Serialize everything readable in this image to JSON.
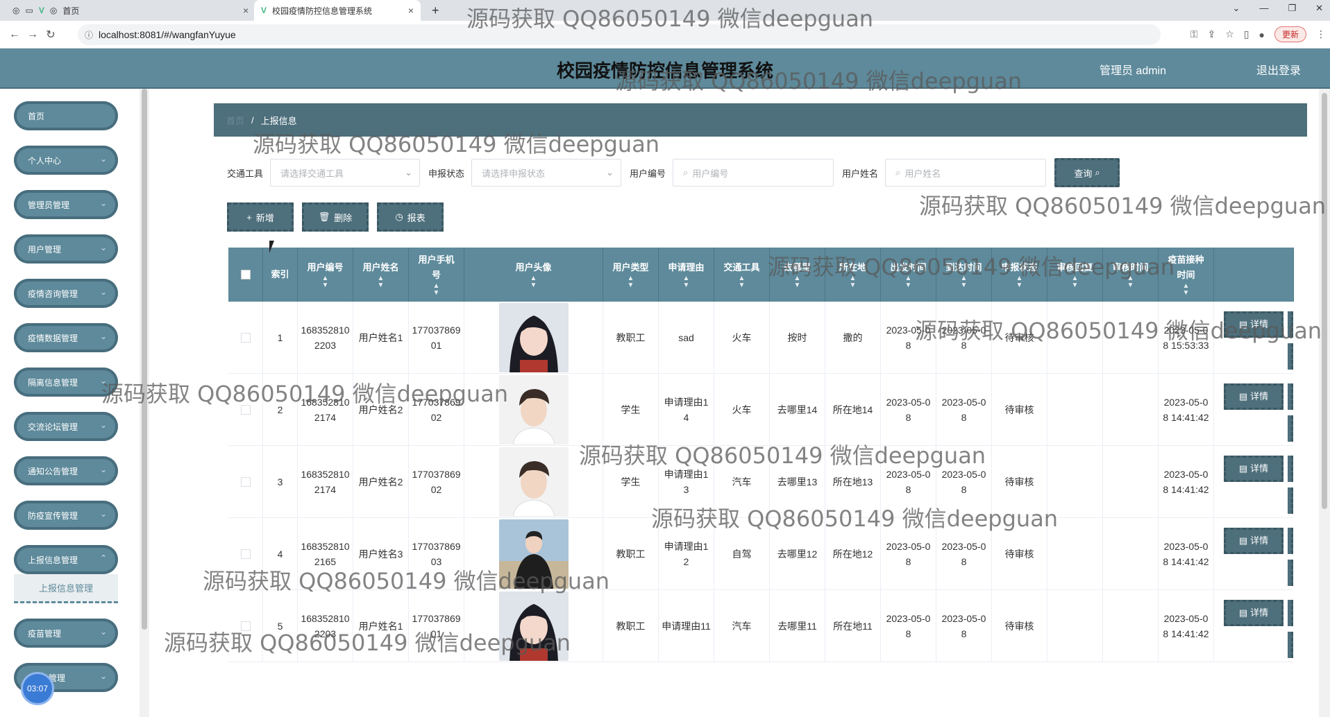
{
  "browser": {
    "tabs": [
      {
        "label": "首页",
        "active": false
      },
      {
        "label": "校园疫情防控信息管理系统",
        "active": true
      }
    ],
    "url": "localhost:8081/#/wangfanYuyue",
    "update_label": "更新"
  },
  "header": {
    "title": "校园疫情防控信息管理系统",
    "user": "管理员 admin",
    "logout": "退出登录"
  },
  "sidebar": {
    "items": [
      {
        "label": "首页"
      },
      {
        "label": "个人中心"
      },
      {
        "label": "管理员管理"
      },
      {
        "label": "用户管理"
      },
      {
        "label": "疫情咨询管理"
      },
      {
        "label": "疫情数据管理"
      },
      {
        "label": "隔离信息管理"
      },
      {
        "label": "交流论坛管理"
      },
      {
        "label": "通知公告管理"
      },
      {
        "label": "防疫宣传管理"
      },
      {
        "label": "上报信息管理"
      },
      {
        "label": "疫苗管理"
      },
      {
        "label": "管理"
      }
    ],
    "active_sub": "上报信息管理",
    "timer": "03:07"
  },
  "breadcrumb": {
    "home": "首页",
    "current": "上报信息"
  },
  "filters": {
    "transport_label": "交通工具",
    "transport_placeholder": "请选择交通工具",
    "status_label": "申报状态",
    "status_placeholder": "请选择申报状态",
    "userno_label": "用户编号",
    "userno_placeholder": "用户编号",
    "username_label": "用户姓名",
    "username_placeholder": "用户姓名",
    "query_label": "查询"
  },
  "actions": {
    "add": "新增",
    "delete": "删除",
    "report": "报表"
  },
  "table": {
    "columns": [
      "索引",
      "用户编号",
      "用户姓名",
      "用户手机号",
      "用户头像",
      "用户类型",
      "申请理由",
      "交通工具",
      "去哪里",
      "所在地",
      "出发时间",
      "到达时间",
      "申报状态",
      "审核回复",
      "审核时间",
      "疫苗接种时间"
    ],
    "detail_label": "详情",
    "rows": [
      {
        "idx": "1",
        "userno": "1683528102203",
        "name": "用户姓名1",
        "phone": "17703786901",
        "type": "教职工",
        "reason": "sad",
        "transport": "火车",
        "dest": "按时",
        "loc": "撒的",
        "depart": "2023-05-08",
        "arrive": "2023-05-08",
        "status": "待审核",
        "reply": "",
        "audit_time": "",
        "vaccine": "2023-05-08 15:53:33",
        "avatar": "girl"
      },
      {
        "idx": "2",
        "userno": "1683528102174",
        "name": "用户姓名2",
        "phone": "17703786902",
        "type": "学生",
        "reason": "申请理由14",
        "transport": "火车",
        "dest": "去哪里14",
        "loc": "所在地14",
        "depart": "2023-05-08",
        "arrive": "2023-05-08",
        "status": "待审核",
        "reply": "",
        "audit_time": "",
        "vaccine": "2023-05-08 14:41:42",
        "avatar": "boy"
      },
      {
        "idx": "3",
        "userno": "1683528102174",
        "name": "用户姓名2",
        "phone": "17703786902",
        "type": "学生",
        "reason": "申请理由13",
        "transport": "汽车",
        "dest": "去哪里13",
        "loc": "所在地13",
        "depart": "2023-05-08",
        "arrive": "2023-05-08",
        "status": "待审核",
        "reply": "",
        "audit_time": "",
        "vaccine": "2023-05-08 14:41:42",
        "avatar": "boy"
      },
      {
        "idx": "4",
        "userno": "1683528102165",
        "name": "用户姓名3",
        "phone": "17703786903",
        "type": "教职工",
        "reason": "申请理由12",
        "transport": "自驾",
        "dest": "去哪里12",
        "loc": "所在地12",
        "depart": "2023-05-08",
        "arrive": "2023-05-08",
        "status": "待审核",
        "reply": "",
        "audit_time": "",
        "vaccine": "2023-05-08 14:41:42",
        "avatar": "man"
      },
      {
        "idx": "5",
        "userno": "1683528102203",
        "name": "用户姓名1",
        "phone": "17703786901",
        "type": "教职工",
        "reason": "申请理由11",
        "transport": "汽车",
        "dest": "去哪里11",
        "loc": "所在地11",
        "depart": "2023-05-08",
        "arrive": "2023-05-08",
        "status": "待审核",
        "reply": "",
        "audit_time": "",
        "vaccine": "2023-05-08 14:41:42",
        "avatar": "girl"
      }
    ]
  },
  "watermark": "源码获取 QQ86050149 微信deepguan",
  "colors": {
    "primary": "#5e8a9b",
    "dark": "#4e6f7c"
  }
}
